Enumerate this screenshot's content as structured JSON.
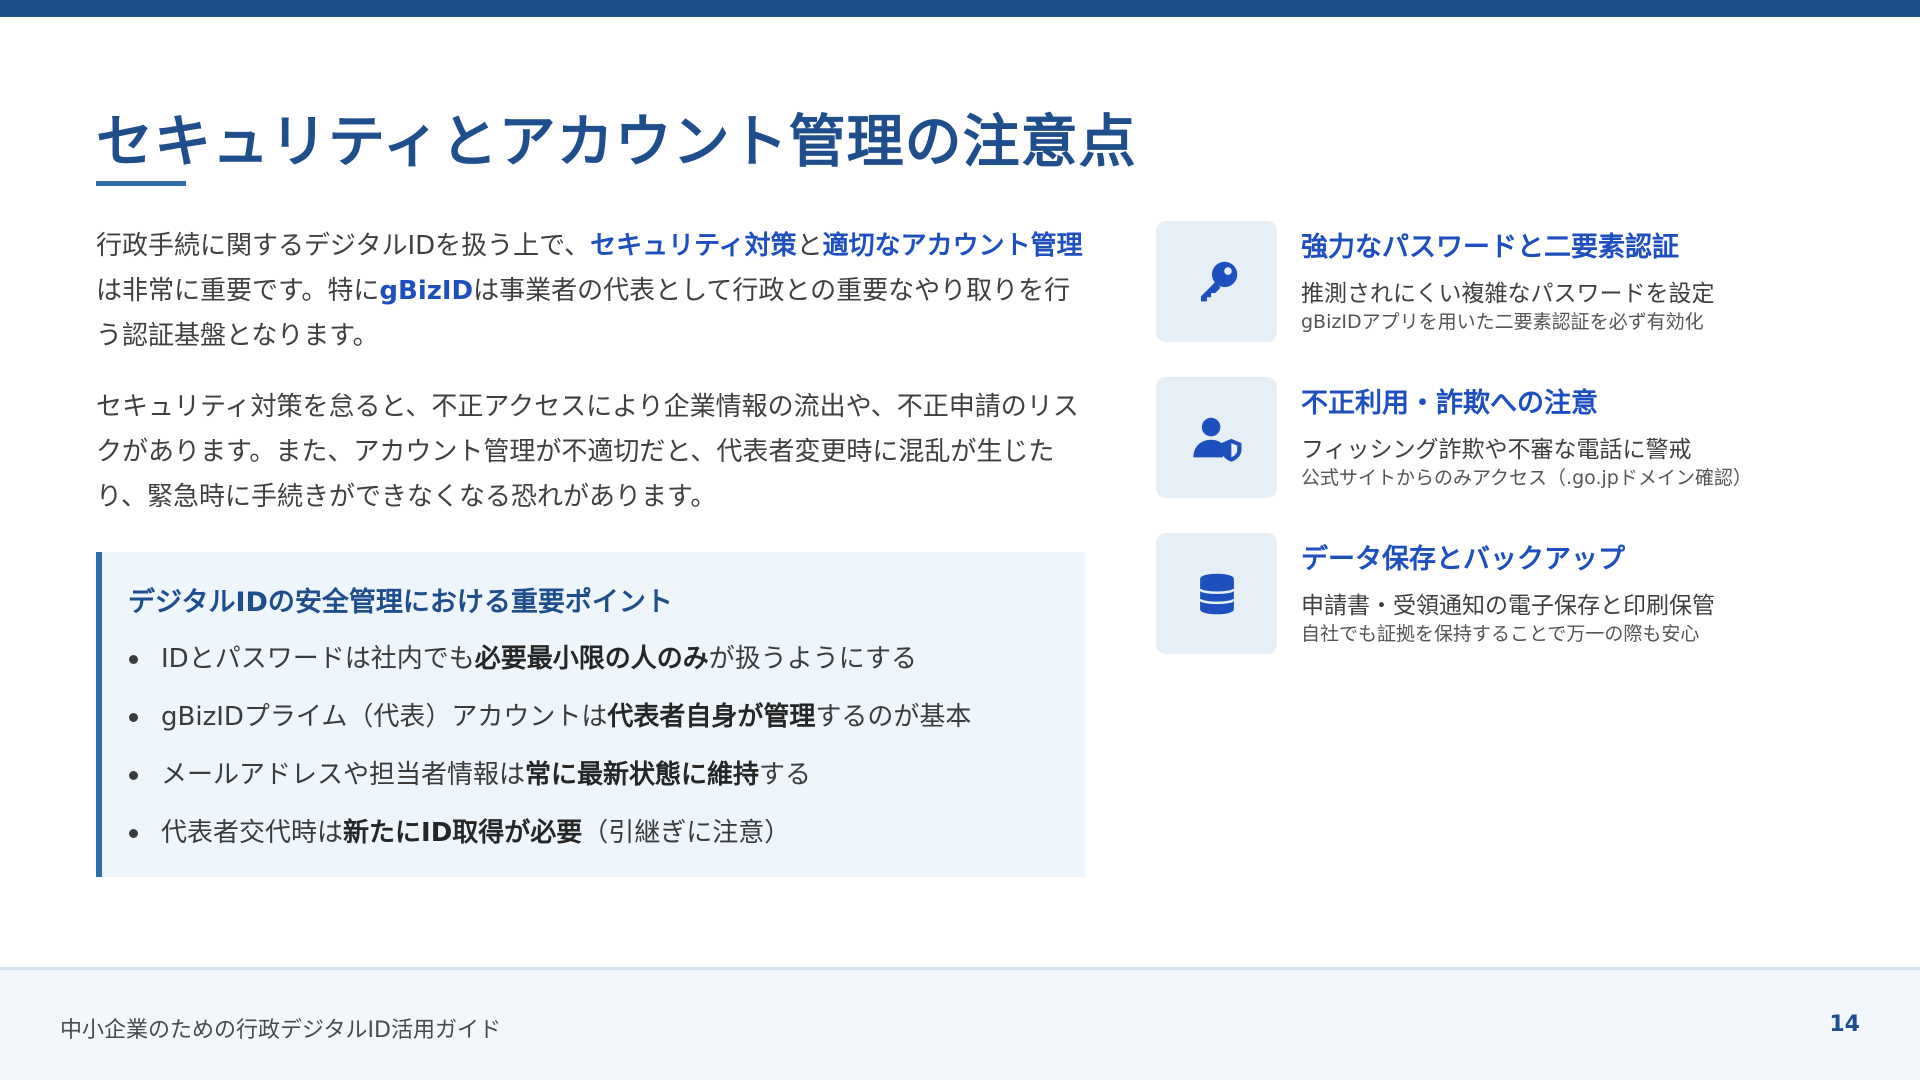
{
  "slide": {
    "title": "セキュリティとアカウント管理の注意点"
  },
  "intro": {
    "p1": {
      "t1": "行政手続に関するデジタルIDを扱う上で、",
      "h1": "セキュリティ対策",
      "t2": "と",
      "h2": "適切なアカウント管理",
      "t3": "は非常に重要です。特に",
      "h3": "gBizID",
      "t4": "は事業者の代表として行政との重要なやり取りを行う認証基盤となります。"
    },
    "p2": "セキュリティ対策を怠ると、不正アクセスにより企業情報の流出や、不正申請のリスクがあります。また、アカウント管理が不適切だと、代表者変更時に混乱が生じたり、緊急時に手続きができなくなる恐れがあります。"
  },
  "callout": {
    "title": "デジタルIDの安全管理における重要ポイント",
    "items": [
      {
        "pre": "IDとパスワードは社内でも",
        "bold": "必要最小限の人のみ",
        "post": "が扱うようにする"
      },
      {
        "pre": "gBizIDプライム（代表）アカウントは",
        "bold": "代表者自身が管理",
        "post": "するのが基本"
      },
      {
        "pre": "メールアドレスや担当者情報は",
        "bold": "常に最新状態に維持",
        "post": "する"
      },
      {
        "pre": "代表者交代時は",
        "bold": "新たにID取得が必要",
        "post": "（引継ぎに注意）"
      }
    ]
  },
  "features": [
    {
      "icon": "key-icon",
      "title": "強力なパスワードと二要素認証",
      "desc": "推測されにくい複雑なパスワードを設定",
      "sub": "gBizIDアプリを用いた二要素認証を必ず有効化"
    },
    {
      "icon": "user-shield-icon",
      "title": "不正利用・詐欺への注意",
      "desc": "フィッシング詐欺や不審な電話に警戒",
      "sub": "公式サイトからのみアクセス（.go.jpドメイン確認）"
    },
    {
      "icon": "database-icon",
      "title": "データ保存とバックアップ",
      "desc": "申請書・受領通知の電子保存と印刷保管",
      "sub": "自社でも証拠を保持することで万一の際も安心"
    }
  ],
  "footer": {
    "text": "中小企業のための行政デジタルID活用ガイド",
    "page": "14"
  },
  "colors": {
    "primary": "#1f4e8c",
    "accent": "#1e4fbe",
    "callout_bg": "#eef6fc",
    "icon_bg": "#e6eef6"
  }
}
